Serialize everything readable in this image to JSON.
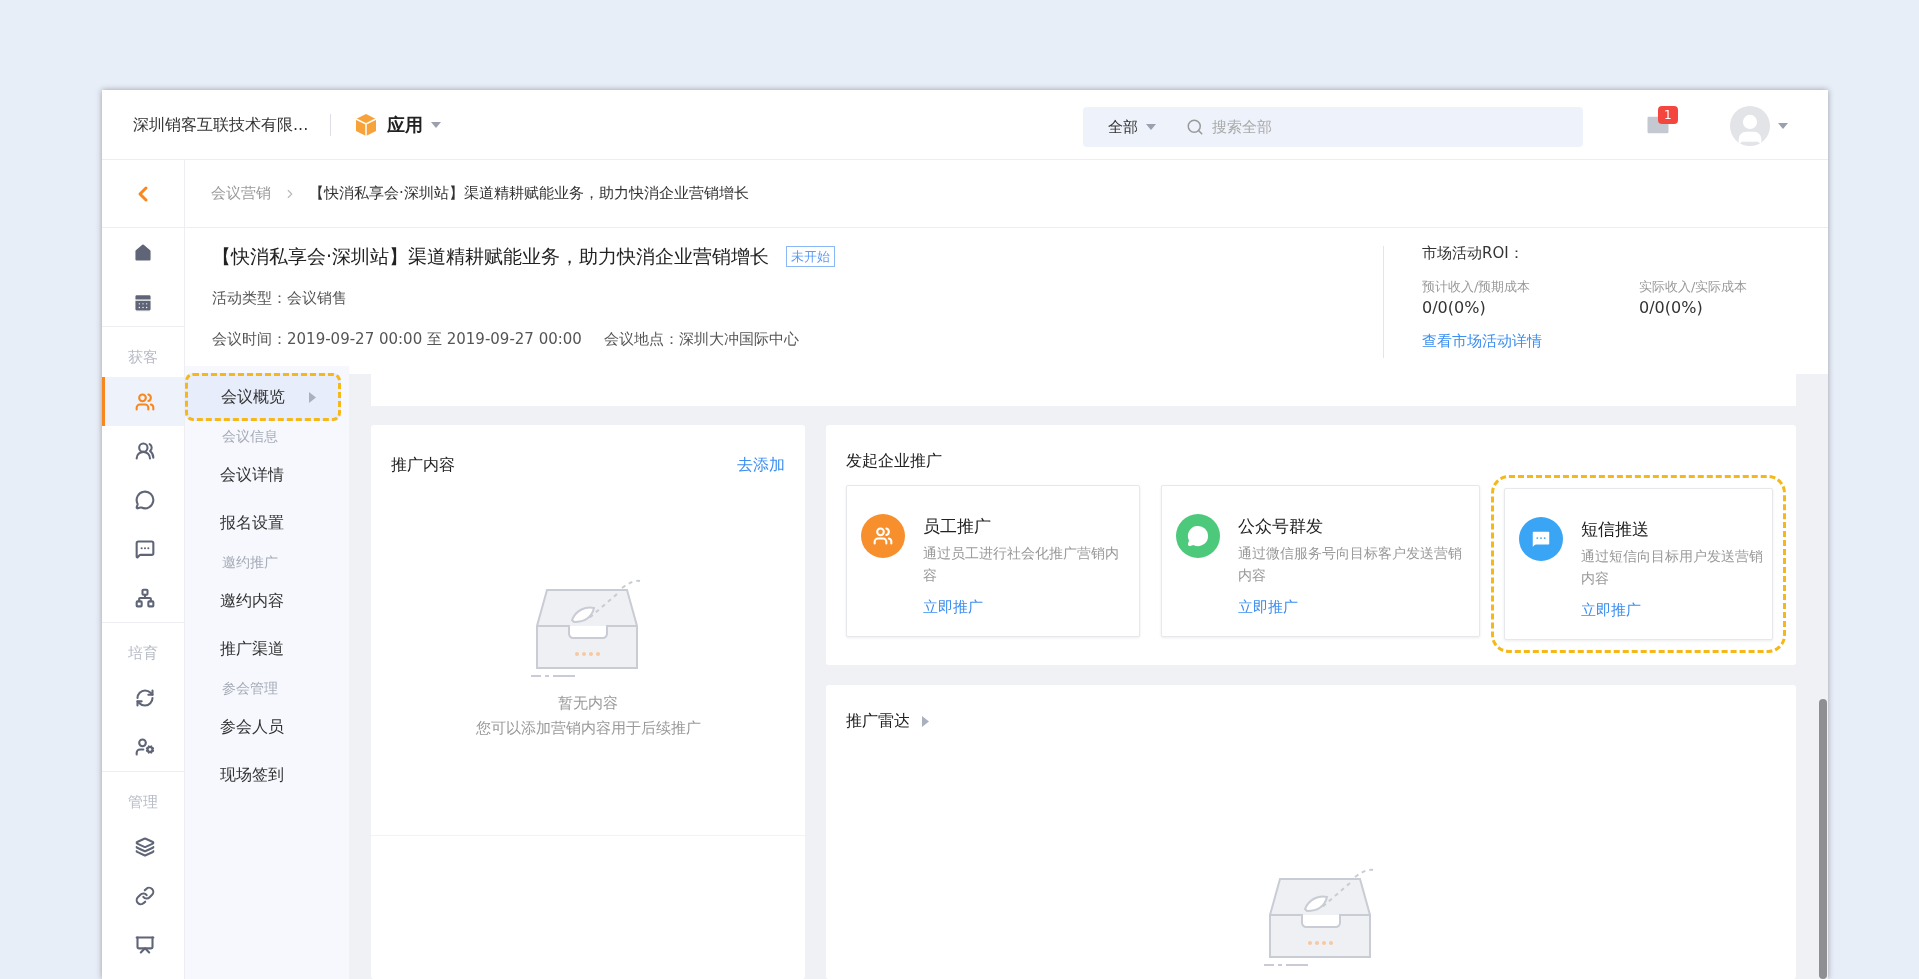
{
  "top_bar": {
    "company": "深圳销客互联技术有限...",
    "app_menu": "应用",
    "search": {
      "scope": "全部",
      "placeholder": "搜索全部"
    },
    "mail_badge": "1"
  },
  "breadcrumb": [
    "会议营销",
    "【快消私享会·深圳站】渠道精耕赋能业务，助力快消企业营销增长"
  ],
  "rail": {
    "top_items": [
      {
        "selected": false
      },
      {
        "selected": false
      }
    ],
    "sections": [
      {
        "label": "获客",
        "items": [
          {
            "selected": true
          },
          {
            "selected": false
          },
          {
            "selected": false
          },
          {
            "selected": false
          },
          {
            "selected": false
          }
        ]
      },
      {
        "label": "培育",
        "items": [
          {
            "selected": false
          },
          {
            "selected": false
          }
        ]
      },
      {
        "label": "管理",
        "items": [
          {
            "selected": false
          },
          {
            "selected": false
          },
          {
            "selected": false
          }
        ]
      }
    ]
  },
  "header": {
    "title": "【快消私享会·深圳站】渠道精耕赋能业务，助力快消企业营销增长",
    "status": "未开始",
    "type": "活动类型：会议销售",
    "time": "会议时间：2019-09-27 00:00 至 2019-09-27 00:00",
    "place": "会议地点：深圳大冲国际中心",
    "roi": {
      "title": "市场活动ROI：",
      "metrics": [
        {
          "label": "预计收入/预期成本",
          "value": "0/0(0%)"
        },
        {
          "label": "实际收入/实际成本",
          "value": "0/0(0%)"
        }
      ],
      "link": "查看市场活动详情"
    }
  },
  "submenu": [
    {
      "kind": "item",
      "label": "会议概览",
      "selected": true
    },
    {
      "kind": "group",
      "label": "会议信息"
    },
    {
      "kind": "item",
      "label": "会议详情",
      "selected": false
    },
    {
      "kind": "item",
      "label": "报名设置",
      "selected": false
    },
    {
      "kind": "group",
      "label": "邀约推广"
    },
    {
      "kind": "item",
      "label": "邀约内容",
      "selected": false
    },
    {
      "kind": "item",
      "label": "推广渠道",
      "selected": false
    },
    {
      "kind": "group",
      "label": "参会管理"
    },
    {
      "kind": "item",
      "label": "参会人员",
      "selected": false
    },
    {
      "kind": "item",
      "label": "现场签到",
      "selected": false
    }
  ],
  "promo_content": {
    "title": "推广内容",
    "action": "去添加",
    "empty_title": "暂无内容",
    "empty_hint": "您可以添加营销内容用于后续推广"
  },
  "enterprise_promo": {
    "title": "发起企业推广",
    "cards": [
      {
        "title": "员工推广",
        "desc": "通过员工进行社会化推广营销内容",
        "action": "立即推广",
        "color": "#f7902c",
        "highlighted": false
      },
      {
        "title": "公众号群发",
        "desc": "通过微信服务号向目标客户发送营销内容",
        "action": "立即推广",
        "color": "#4cc97a",
        "highlighted": false
      },
      {
        "title": "短信推送",
        "desc": "通过短信向目标用户发送营销内容",
        "action": "立即推广",
        "color": "#3aa4f5",
        "highlighted": true
      }
    ]
  },
  "radar": {
    "title": "推广雷达"
  }
}
